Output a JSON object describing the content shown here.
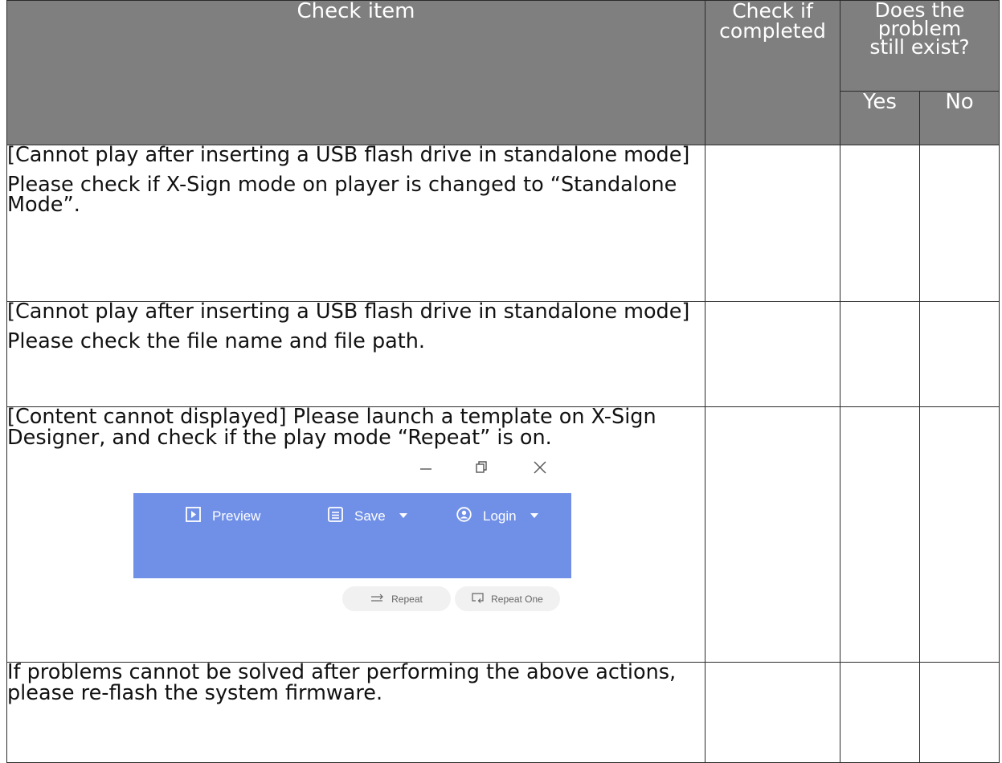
{
  "header": {
    "check_item": "Check item",
    "check_completed_line1": "Check if",
    "check_completed_line2": "completed",
    "exist_line1": "Does the",
    "exist_line2": "problem",
    "exist_line3": "still exist?",
    "yes": "Yes",
    "no": "No"
  },
  "rows": [
    {
      "paragraphs": [
        "[Cannot play after inserting a USB flash drive in standalone mode]",
        "Please check if X-Sign mode on player is changed to “Standalone Mode”."
      ]
    },
    {
      "paragraphs": [
        "[Cannot play after inserting a USB flash drive in standalone mode]",
        "Please check the file name and file path."
      ]
    },
    {
      "paragraphs": [
        "[Content cannot displayed] Please launch a template on X-Sign Designer, and check if the play mode “Repeat” is on."
      ],
      "screenshot": {
        "toolbar": {
          "preview_label": "Preview",
          "save_label": "Save",
          "login_label": "Login"
        },
        "play_modes": {
          "repeat_label": "Repeat",
          "repeat_one_label": "Repeat One"
        },
        "colors": {
          "toolbar_bg": "#7090e8",
          "pill_bg": "#f1f1f1"
        },
        "icons": [
          "minimize-icon",
          "restore-icon",
          "close-icon",
          "play-square-icon",
          "save-document-icon",
          "user-circle-icon",
          "repeat-arrows-icon",
          "repeat-one-icon"
        ]
      }
    },
    {
      "paragraphs": [
        "If problems cannot be solved after performing the above actions, please re-flash the system firmware."
      ]
    }
  ],
  "colors": {
    "header_bg": "#7f7f7f",
    "header_text": "#ffffff",
    "border": "#2b2b2b"
  }
}
